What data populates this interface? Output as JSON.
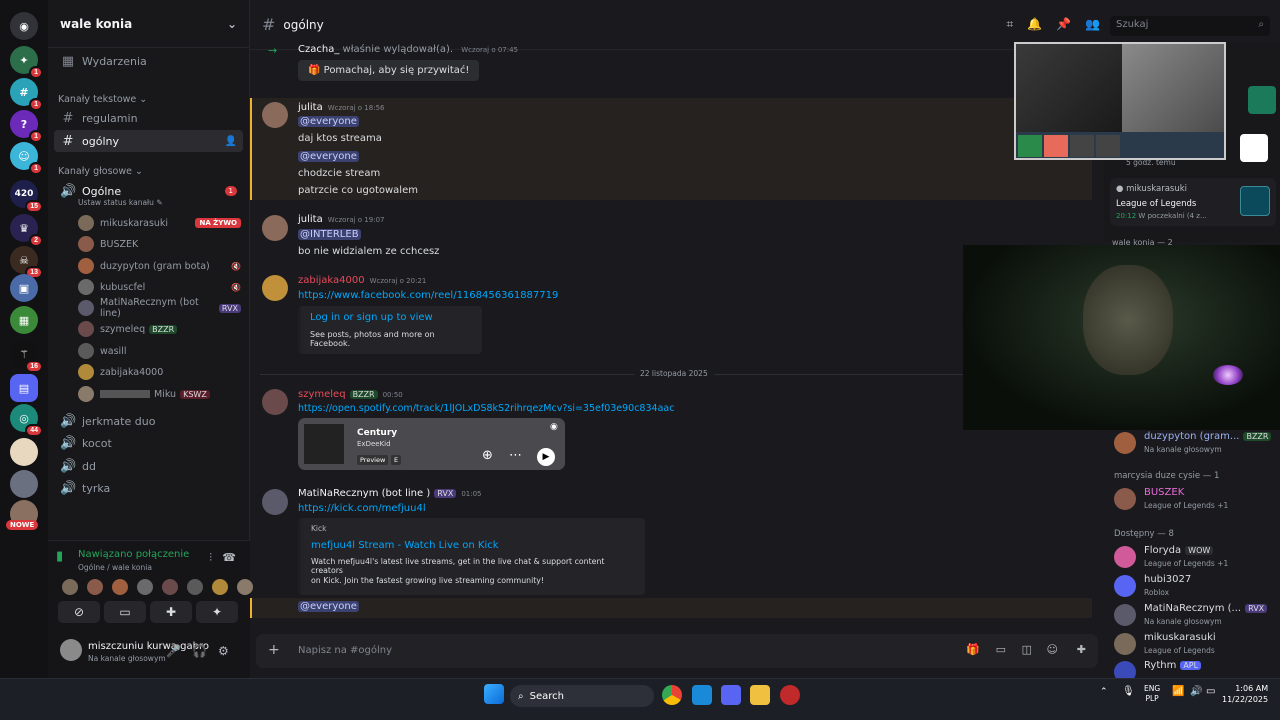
{
  "server": {
    "name": "wale konia",
    "badges": [
      "1",
      "1",
      "1",
      "1",
      "15",
      "2",
      "13",
      "16",
      "44"
    ],
    "new_label": "NOWE"
  },
  "sidebar": {
    "events": "Wydarzenia",
    "text_category": "Kanały tekstowe",
    "text_channels": [
      "regulamin",
      "ogólny"
    ],
    "voice_category": "Kanały głosowe",
    "voice_main": {
      "name": "Ogólne",
      "status": "Ustaw status kanału",
      "badge": "1"
    },
    "voice_users": [
      {
        "name": "mikuskarasuki",
        "live": "NA ŻYWO"
      },
      {
        "name": "BUSZEK"
      },
      {
        "name": "duzypyton (gram bota)"
      },
      {
        "name": "kubuscfel"
      },
      {
        "name": "MatiNaRecznym (bot line)",
        "tag": "RVX"
      },
      {
        "name": "szymeleq",
        "tag": "BZZR"
      },
      {
        "name": "wasill"
      },
      {
        "name": "zabijaka4000"
      },
      {
        "name": "Miku",
        "tag": "KSWZ"
      }
    ],
    "voice_channels": [
      "jerkmate duo",
      "kocot",
      "dd",
      "tyrka"
    ]
  },
  "voice_panel": {
    "status": "Nawiązano połączenie",
    "sub": "Ogólne / wale konia",
    "user": "miszczuniu kurwa gabro",
    "user_status": "Na kanale głosowym"
  },
  "channel": {
    "name": "ogólny",
    "search_placeholder": "Szukaj",
    "input_placeholder": "Napisz na #ogólny"
  },
  "messages": {
    "join": {
      "name": "Czacha_",
      "text": "właśnie wylądował(a).",
      "time": "Wczoraj o 07:45",
      "wave": "Pomachaj, aby się przywitać!"
    },
    "m1": {
      "name": "julita",
      "time": "Wczoraj o 18:56",
      "lines": [
        "@everyone",
        "daj ktos streama",
        "@everyone",
        "chodzcie stream",
        "patrzcie co ugotowalem"
      ]
    },
    "m2": {
      "name": "julita",
      "time": "Wczoraj o 19:07",
      "mention": "@INTERLEB",
      "text": "bo nie widzialem ze cchcesz"
    },
    "m3": {
      "name": "zabijaka4000",
      "time": "Wczoraj o 20:21",
      "link": "https://www.facebook.com/reel/1168456361887719",
      "embed_title": "Log in or sign up to view",
      "embed_desc": "See posts, photos and more on Facebook."
    },
    "divider": "22 listopada 2025",
    "m4": {
      "name": "szymeleq",
      "tag": "BZZR",
      "time": "00:50",
      "link": "https://open.spotify.com/track/1lJOLxDS8kS2rihrqezMcv?si=35ef03e90c834aac",
      "track": "Century",
      "artist": "ExDeeKid",
      "preview": "Preview",
      "explicit": "E"
    },
    "m5": {
      "name": "MatiNaRecznym (bot line )",
      "tag": "RVX",
      "time": "01:05",
      "link": "https://kick.com/mefjuu4l",
      "provider": "Kick",
      "embed_title": "mefjuu4l Stream - Watch Live on Kick",
      "embed_desc1": "Watch mefjuu4l's latest live streams, get in the live chat & support content creators",
      "embed_desc2": "on Kick. Join the fastest growing live streaming community!"
    },
    "m6": {
      "mention": "@everyone"
    }
  },
  "right_panel": {
    "top_ago": "5 godz. temu",
    "activity": {
      "name": "mikuskarasuki",
      "game": "League of Legends",
      "time": "20:12",
      "status": "W poczekalni (4 z..."
    },
    "voice_label": "wale konia — 2"
  },
  "members": {
    "top": {
      "name": "duzypyton (gram...",
      "tag": "BZZR",
      "status": "Na kanale głosowym"
    },
    "section1": "marcysia duze cysie — 1",
    "buszek": {
      "name": "BUSZEK",
      "status": "League of Legends +1"
    },
    "section2": "Dostępny — 8",
    "list": [
      {
        "name": "Floryda",
        "tag": "WOW",
        "status": "League of Legends +1"
      },
      {
        "name": "hubi3027",
        "status": "Roblox"
      },
      {
        "name": "MatiNaRecznym (...",
        "tag": "RVX",
        "status": "Na kanale głosowym"
      },
      {
        "name": "mikuskarasuki",
        "status": "League of Legends"
      },
      {
        "name": "Rythm",
        "tag": "APL"
      }
    ]
  },
  "taskbar": {
    "search": "Search",
    "lang1": "ENG",
    "lang2": "PLP",
    "time": "1:06 AM",
    "date": "11/22/2025"
  },
  "colors": {
    "accent": "#5865f2",
    "link": "#00a8fc",
    "live": "#da373c",
    "green": "#23a55a"
  }
}
